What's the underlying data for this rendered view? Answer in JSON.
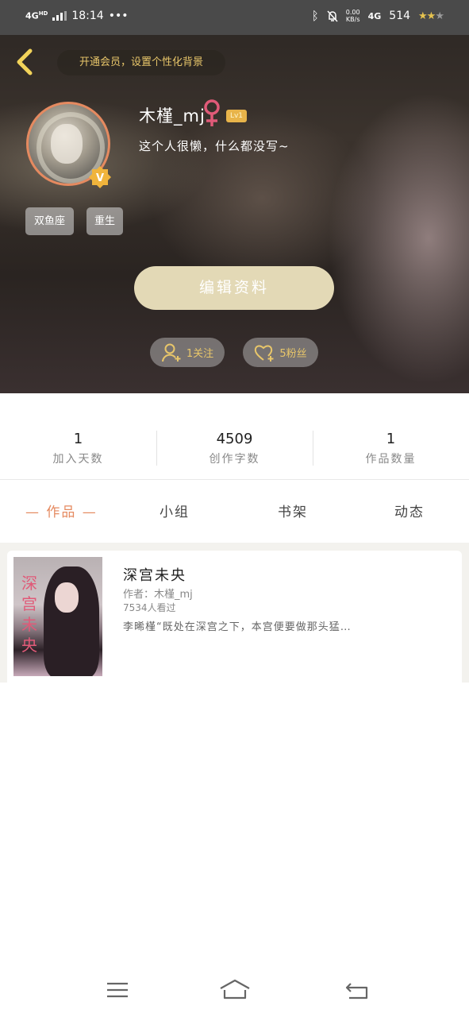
{
  "status_bar": {
    "network": "4G",
    "network_sup": "HD",
    "time": "18:14",
    "dots": "•••",
    "speed_value": "0.00",
    "speed_unit": "KB/s",
    "network2": "4G",
    "battery": "514"
  },
  "header": {
    "vip_banner": "开通会员，设置个性化背景",
    "username": "木槿_mj",
    "level": "Lv1",
    "bio": "这个人很懒，什么都没写~",
    "vip_badge": "V",
    "tags": [
      "双鱼座",
      "重生"
    ],
    "edit_button": "编辑资料",
    "follow": "1关注",
    "fans": "5粉丝"
  },
  "stats": [
    {
      "value": "1",
      "label": "加入天数"
    },
    {
      "value": "4509",
      "label": "创作字数"
    },
    {
      "value": "1",
      "label": "作品数量"
    }
  ],
  "tabs": {
    "works": "— 作品 —",
    "group": "小组",
    "shelf": "书架",
    "activity": "动态"
  },
  "book": {
    "title": "深宫未央",
    "author": "作者：木槿_mj",
    "views": "7534人看过",
    "description": "李晞槿“既处在深宫之下，本宫便要做那头猛…",
    "cover_text": "深宫未央"
  },
  "colors": {
    "accent": "#e58a60",
    "gold": "#e8c66a",
    "button": "#e3d9b6",
    "gender": "#e05a78"
  },
  "icons": {
    "back": "chevron-left-icon",
    "gender": "female-symbol-icon",
    "follow": "add-user-icon",
    "fans": "heart-icon",
    "menu": "menu-icon",
    "home": "home-icon",
    "return": "return-icon"
  }
}
